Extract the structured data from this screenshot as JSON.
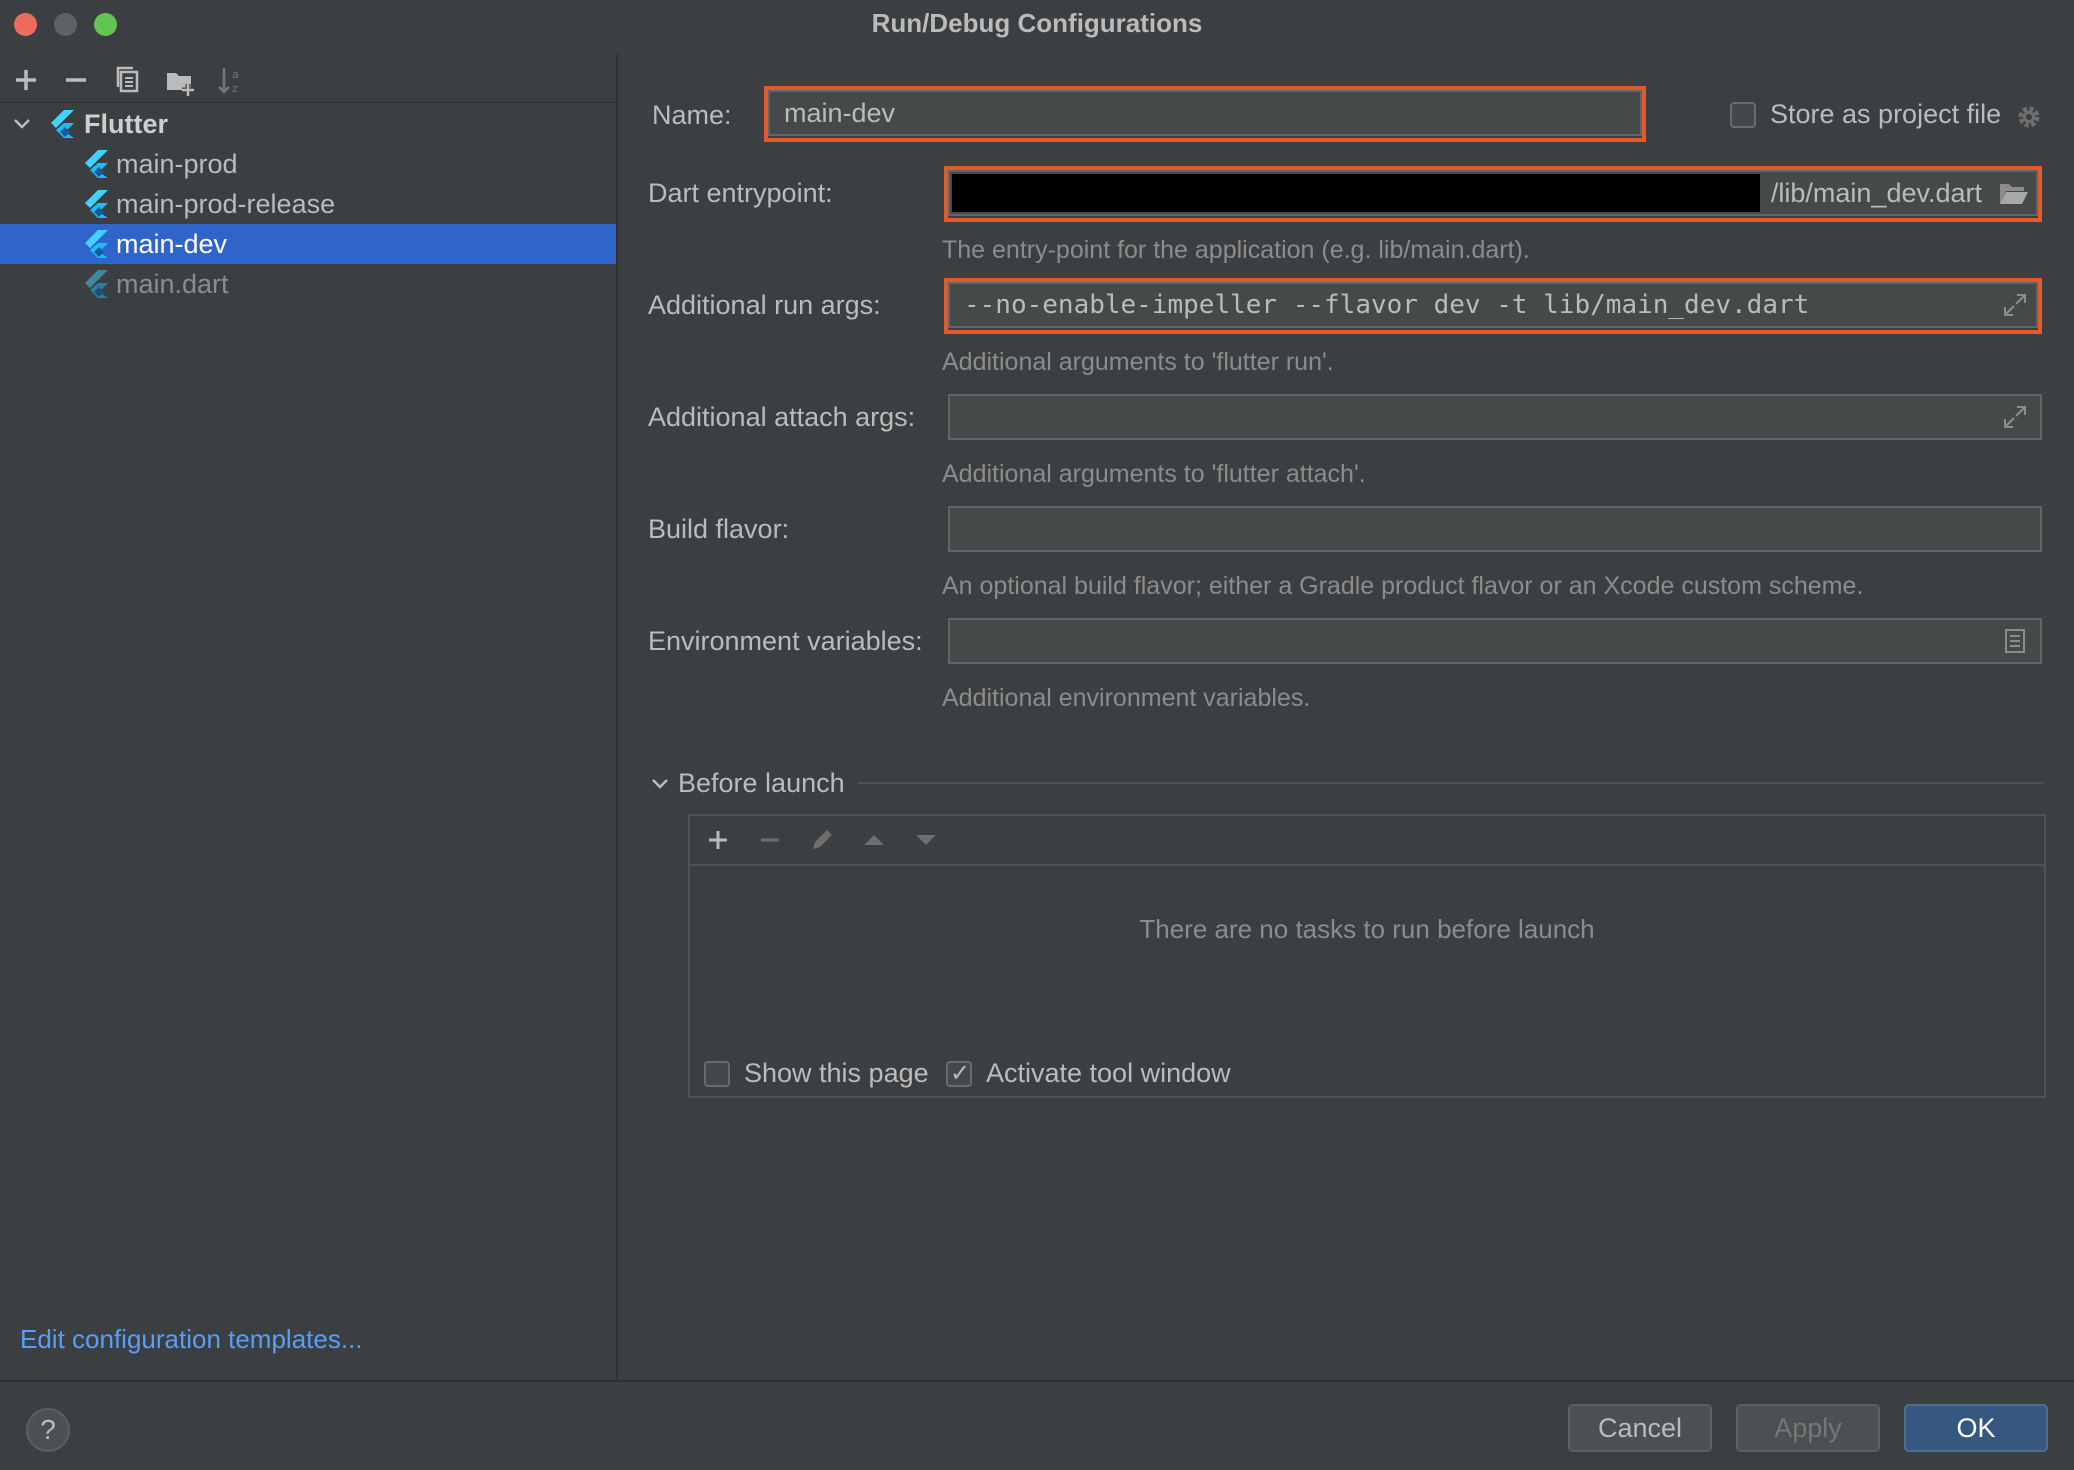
{
  "window": {
    "title": "Run/Debug Configurations"
  },
  "toolbar": {
    "icons": [
      "plus-icon",
      "minus-icon",
      "copy-icon",
      "folder-add-icon",
      "sort-alpha-icon"
    ]
  },
  "tree": {
    "root": {
      "label": "Flutter",
      "expanded": true
    },
    "items": [
      {
        "label": "main-prod",
        "selected": false
      },
      {
        "label": "main-prod-release",
        "selected": false
      },
      {
        "label": "main-dev",
        "selected": true
      },
      {
        "label": "main.dart",
        "selected": false,
        "temporary": true
      }
    ]
  },
  "edit_templates_link": "Edit configuration templates...",
  "form": {
    "name_label": "Name:",
    "name_value": "main-dev",
    "store_as_project_file": {
      "label": "Store as project file",
      "checked": false
    },
    "dart_entrypoint": {
      "label": "Dart entrypoint:",
      "value": "/lib/main_dev.dart",
      "hint": "The entry-point for the application (e.g. lib/main.dart)."
    },
    "run_args": {
      "label": "Additional run args:",
      "value": "--no-enable-impeller --flavor dev -t lib/main_dev.dart",
      "hint": "Additional arguments to 'flutter run'."
    },
    "attach_args": {
      "label": "Additional attach args:",
      "value": "",
      "hint": "Additional arguments to 'flutter attach'."
    },
    "build_flavor": {
      "label": "Build flavor:",
      "value": "",
      "hint": "An optional build flavor; either a Gradle product flavor or an Xcode custom scheme."
    },
    "env_vars": {
      "label": "Environment variables:",
      "value": "",
      "hint": "Additional environment variables."
    }
  },
  "before_launch": {
    "title": "Before launch",
    "empty_text": "There are no tasks to run before launch",
    "show_this_page": {
      "label": "Show this page",
      "checked": false
    },
    "activate_tool_window": {
      "label": "Activate tool window",
      "checked": true
    }
  },
  "buttons": {
    "help": "?",
    "cancel": "Cancel",
    "apply": "Apply",
    "ok": "OK"
  },
  "colors": {
    "background": "#3c3f41",
    "selection": "#2f65ca",
    "highlight": "#e15a2d",
    "link": "#589df6",
    "primary_button": "#365880"
  }
}
